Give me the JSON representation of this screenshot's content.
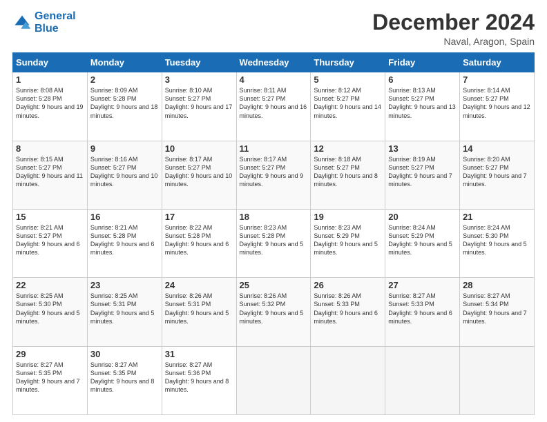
{
  "header": {
    "logo_line1": "General",
    "logo_line2": "Blue",
    "month": "December 2024",
    "location": "Naval, Aragon, Spain"
  },
  "weekdays": [
    "Sunday",
    "Monday",
    "Tuesday",
    "Wednesday",
    "Thursday",
    "Friday",
    "Saturday"
  ],
  "weeks": [
    [
      {
        "day": "1",
        "sunrise": "8:08 AM",
        "sunset": "5:28 PM",
        "daylight": "9 hours and 19 minutes."
      },
      {
        "day": "2",
        "sunrise": "8:09 AM",
        "sunset": "5:28 PM",
        "daylight": "9 hours and 18 minutes."
      },
      {
        "day": "3",
        "sunrise": "8:10 AM",
        "sunset": "5:27 PM",
        "daylight": "9 hours and 17 minutes."
      },
      {
        "day": "4",
        "sunrise": "8:11 AM",
        "sunset": "5:27 PM",
        "daylight": "9 hours and 16 minutes."
      },
      {
        "day": "5",
        "sunrise": "8:12 AM",
        "sunset": "5:27 PM",
        "daylight": "9 hours and 14 minutes."
      },
      {
        "day": "6",
        "sunrise": "8:13 AM",
        "sunset": "5:27 PM",
        "daylight": "9 hours and 13 minutes."
      },
      {
        "day": "7",
        "sunrise": "8:14 AM",
        "sunset": "5:27 PM",
        "daylight": "9 hours and 12 minutes."
      }
    ],
    [
      {
        "day": "8",
        "sunrise": "8:15 AM",
        "sunset": "5:27 PM",
        "daylight": "9 hours and 11 minutes."
      },
      {
        "day": "9",
        "sunrise": "8:16 AM",
        "sunset": "5:27 PM",
        "daylight": "9 hours and 10 minutes."
      },
      {
        "day": "10",
        "sunrise": "8:17 AM",
        "sunset": "5:27 PM",
        "daylight": "9 hours and 10 minutes."
      },
      {
        "day": "11",
        "sunrise": "8:17 AM",
        "sunset": "5:27 PM",
        "daylight": "9 hours and 9 minutes."
      },
      {
        "day": "12",
        "sunrise": "8:18 AM",
        "sunset": "5:27 PM",
        "daylight": "9 hours and 8 minutes."
      },
      {
        "day": "13",
        "sunrise": "8:19 AM",
        "sunset": "5:27 PM",
        "daylight": "9 hours and 7 minutes."
      },
      {
        "day": "14",
        "sunrise": "8:20 AM",
        "sunset": "5:27 PM",
        "daylight": "9 hours and 7 minutes."
      }
    ],
    [
      {
        "day": "15",
        "sunrise": "8:21 AM",
        "sunset": "5:27 PM",
        "daylight": "9 hours and 6 minutes."
      },
      {
        "day": "16",
        "sunrise": "8:21 AM",
        "sunset": "5:28 PM",
        "daylight": "9 hours and 6 minutes."
      },
      {
        "day": "17",
        "sunrise": "8:22 AM",
        "sunset": "5:28 PM",
        "daylight": "9 hours and 6 minutes."
      },
      {
        "day": "18",
        "sunrise": "8:23 AM",
        "sunset": "5:28 PM",
        "daylight": "9 hours and 5 minutes."
      },
      {
        "day": "19",
        "sunrise": "8:23 AM",
        "sunset": "5:29 PM",
        "daylight": "9 hours and 5 minutes."
      },
      {
        "day": "20",
        "sunrise": "8:24 AM",
        "sunset": "5:29 PM",
        "daylight": "9 hours and 5 minutes."
      },
      {
        "day": "21",
        "sunrise": "8:24 AM",
        "sunset": "5:30 PM",
        "daylight": "9 hours and 5 minutes."
      }
    ],
    [
      {
        "day": "22",
        "sunrise": "8:25 AM",
        "sunset": "5:30 PM",
        "daylight": "9 hours and 5 minutes."
      },
      {
        "day": "23",
        "sunrise": "8:25 AM",
        "sunset": "5:31 PM",
        "daylight": "9 hours and 5 minutes."
      },
      {
        "day": "24",
        "sunrise": "8:26 AM",
        "sunset": "5:31 PM",
        "daylight": "9 hours and 5 minutes."
      },
      {
        "day": "25",
        "sunrise": "8:26 AM",
        "sunset": "5:32 PM",
        "daylight": "9 hours and 5 minutes."
      },
      {
        "day": "26",
        "sunrise": "8:26 AM",
        "sunset": "5:33 PM",
        "daylight": "9 hours and 6 minutes."
      },
      {
        "day": "27",
        "sunrise": "8:27 AM",
        "sunset": "5:33 PM",
        "daylight": "9 hours and 6 minutes."
      },
      {
        "day": "28",
        "sunrise": "8:27 AM",
        "sunset": "5:34 PM",
        "daylight": "9 hours and 7 minutes."
      }
    ],
    [
      {
        "day": "29",
        "sunrise": "8:27 AM",
        "sunset": "5:35 PM",
        "daylight": "9 hours and 7 minutes."
      },
      {
        "day": "30",
        "sunrise": "8:27 AM",
        "sunset": "5:35 PM",
        "daylight": "9 hours and 8 minutes."
      },
      {
        "day": "31",
        "sunrise": "8:27 AM",
        "sunset": "5:36 PM",
        "daylight": "9 hours and 8 minutes."
      },
      null,
      null,
      null,
      null
    ]
  ]
}
